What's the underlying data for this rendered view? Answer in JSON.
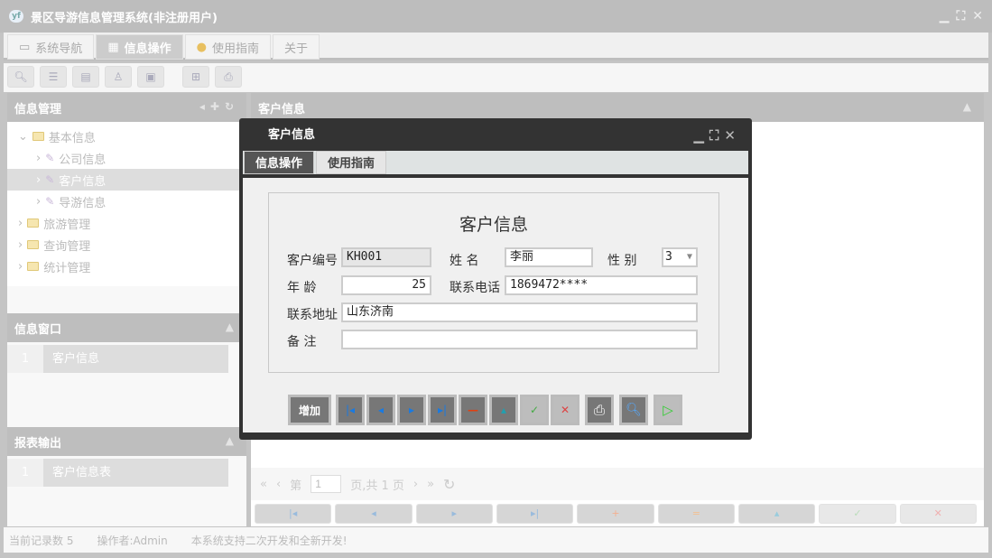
{
  "app": {
    "title": "景区导游信息管理系统(非注册用户)"
  },
  "menu_tabs": [
    {
      "label": "系统导航",
      "icon": "monitor-icon"
    },
    {
      "label": "信息操作",
      "icon": "grid-icon"
    },
    {
      "label": "使用指南",
      "icon": "help-icon"
    },
    {
      "label": "关于",
      "icon": ""
    }
  ],
  "toolbar": [
    "search-icon",
    "list-icon",
    "document-icon",
    "user-icon",
    "window-icon",
    "add-window-icon",
    "print-icon"
  ],
  "left": {
    "nav_title": "信息管理",
    "tree": [
      {
        "label": "基本信息",
        "level": 0,
        "expanded": true
      },
      {
        "label": "公司信息",
        "level": 1
      },
      {
        "label": "客户信息",
        "level": 1,
        "selected": true
      },
      {
        "label": "导游信息",
        "level": 1
      },
      {
        "label": "旅游管理",
        "level": 0
      },
      {
        "label": "查询管理",
        "level": 0
      },
      {
        "label": "统计管理",
        "level": 0
      }
    ],
    "window_title": "信息窗口",
    "window_items": [
      {
        "num": "1",
        "label": "客户信息"
      }
    ],
    "report_title": "报表输出",
    "report_items": [
      {
        "num": "1",
        "label": "客户信息表"
      }
    ]
  },
  "right": {
    "title": "客户信息"
  },
  "pager": {
    "page_prefix": "第",
    "page": "1",
    "page_suffix": "页,共 1 页"
  },
  "status": {
    "records": "当前记录数 5",
    "operator": "操作者:Admin",
    "message": "本系统支持二次开发和全新开发!"
  },
  "modal": {
    "title": "客户信息",
    "tabs": [
      "信息操作",
      "使用指南"
    ],
    "form_title": "客户信息",
    "fields": {
      "id_label": "客户编号",
      "id": "KH001",
      "name_label": "姓 名",
      "name": "李丽",
      "gender_label": "性 别",
      "gender": "3",
      "age_label": "年 龄",
      "age": "25",
      "phone_label": "联系电话",
      "phone": "1869472****",
      "address_label": "联系地址",
      "address": "山东济南",
      "note_label": "备 注",
      "note": ""
    },
    "add_label": "增加"
  },
  "colors": {
    "dialog": "#333333",
    "sidebar_header": "#bebebe"
  }
}
